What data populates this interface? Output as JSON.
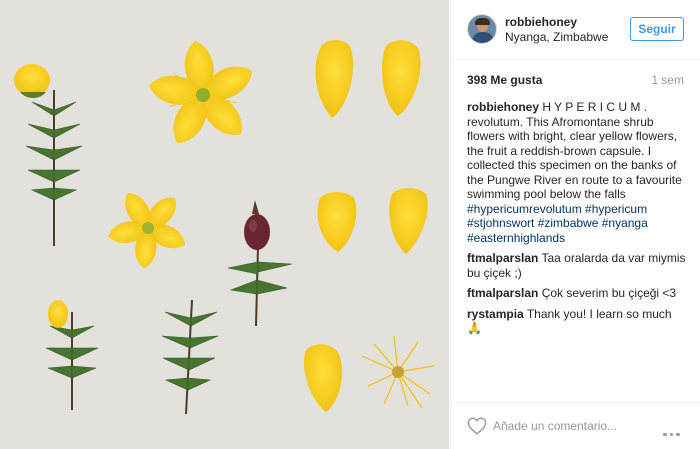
{
  "post": {
    "photo_alt": "",
    "author": {
      "username": "robbiehoney",
      "location": "Nyanga, Zimbabwe"
    },
    "follow_label": "Seguir",
    "likes_text": "398 Me gusta",
    "time_ago": "1 sem",
    "caption": {
      "username": "robbiehoney",
      "text": "H Y P E R I C U M . revolutum. This Afromontane shrub flowers with bright, clear yellow flowers, the fruit a reddish-brown capsule. I collected this specimen on the banks of the Pungwe River en route to a favourite swimming pool below the falls ",
      "hashtags": "#hypericumrevolutum #hypericum #stjohnswort #zimbabwe #nyanga #easternhighlands"
    },
    "comments": [
      {
        "username": "ftmalparslan",
        "text": "Taa oralarda da var miymis bu çiçek ;)"
      },
      {
        "username": "ftmalparslan",
        "text": "Çok severim bu çiçeği <3"
      },
      {
        "username": "rystampia",
        "text": "Thank you! I learn so much 🙏"
      }
    ],
    "comment_placeholder": "Añade un comentario...",
    "icons": {
      "like": "heart-outline-icon",
      "options": "more-dots-icon"
    },
    "colors": {
      "link_blue": "#3897f0",
      "hashtag": "#003569",
      "muted": "#999999",
      "petal_yellow": "#f5c518"
    }
  }
}
